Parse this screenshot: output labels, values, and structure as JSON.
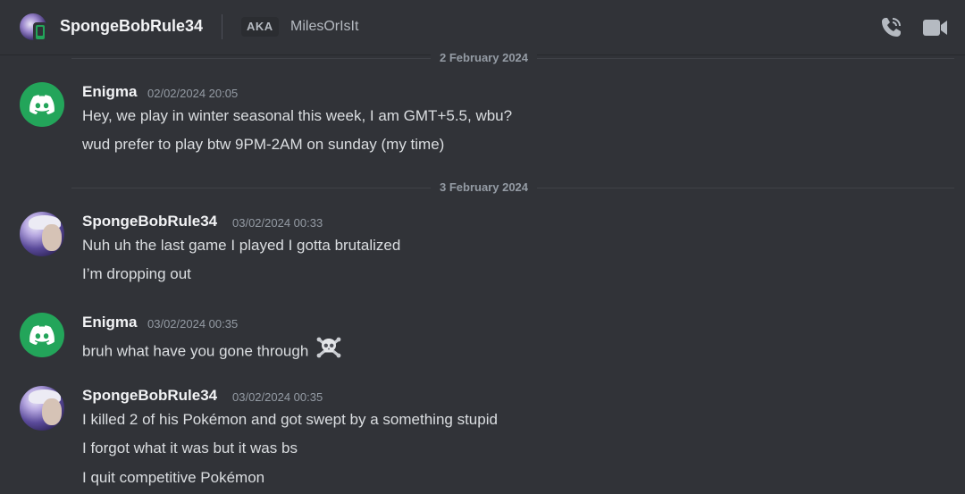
{
  "header": {
    "title": "SpongeBobRule34",
    "aka_label": "AKA",
    "aka_name": "MilesOrIsIt",
    "status_icon": "mobile-online-icon",
    "actions": [
      "voice-call-icon",
      "video-call-icon"
    ]
  },
  "colors": {
    "background": "#313338",
    "online_green": "#23a55a",
    "text_muted": "#949ba4"
  },
  "dates": [
    "2 February 2024",
    "3 February 2024"
  ],
  "messages": [
    {
      "author": "Enigma",
      "avatar": "discord-default-avatar",
      "time": "02/02/2024 20:05",
      "lines": [
        "Hey, we play in winter seasonal this week, I am GMT+5.5, wbu?",
        "wud prefer to play btw 9PM-2AM on sunday (my time)"
      ]
    },
    {
      "author": "SpongeBobRule34",
      "avatar": "anime-character-avatar",
      "time": "03/02/2024 00:33",
      "lines": [
        "Nuh uh the last game I played I gotta brutalized",
        "I’m dropping out"
      ]
    },
    {
      "author": "Enigma",
      "avatar": "discord-default-avatar",
      "time": "03/02/2024 00:35",
      "lines": [
        "bruh what have you gone through"
      ],
      "emoji": "skull-and-crossbones-icon"
    },
    {
      "author": "SpongeBobRule34",
      "avatar": "anime-character-avatar",
      "time": "03/02/2024 00:35",
      "lines": [
        "I killed 2 of his Pokémon and got swept by a something stupid",
        "I forgot what it was but it was bs",
        "I quit competitive Pokémon"
      ]
    }
  ]
}
